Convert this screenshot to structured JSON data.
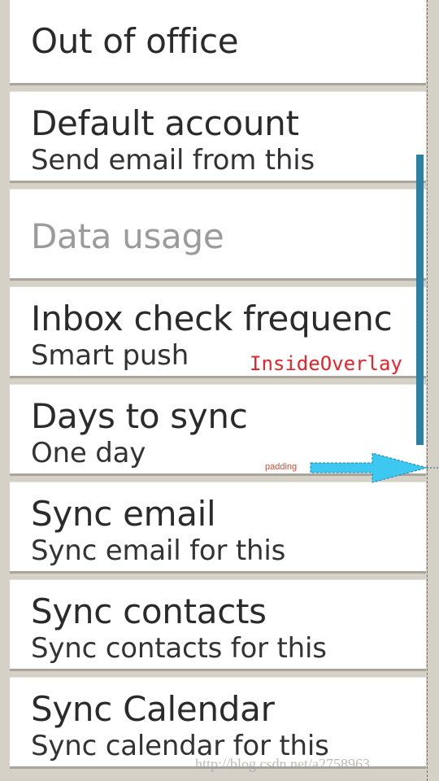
{
  "settings": {
    "items": [
      {
        "title": "Out of office",
        "summary": "",
        "enabled": true
      },
      {
        "title": "Default account",
        "summary": "Send email from this",
        "enabled": true
      },
      {
        "title": "Data usage",
        "summary": "",
        "enabled": false
      },
      {
        "title": "Inbox check frequenc",
        "summary": "Smart push",
        "enabled": true
      },
      {
        "title": "Days to sync",
        "summary": "One day",
        "enabled": true
      },
      {
        "title": "Sync email",
        "summary": "Sync email for this",
        "enabled": true
      },
      {
        "title": "Sync contacts",
        "summary": "Sync contacts for this",
        "enabled": true
      },
      {
        "title": "Sync Calendar",
        "summary": "Sync calendar for this",
        "enabled": true
      }
    ]
  },
  "annotations": {
    "overlay_label": "InsideOverlay",
    "padding_label": "padding",
    "arrow_color": "#3cc8f0",
    "scrollbar_color": "#2f7fa3"
  },
  "watermark": "http://blog.csdn.net/a2758963"
}
